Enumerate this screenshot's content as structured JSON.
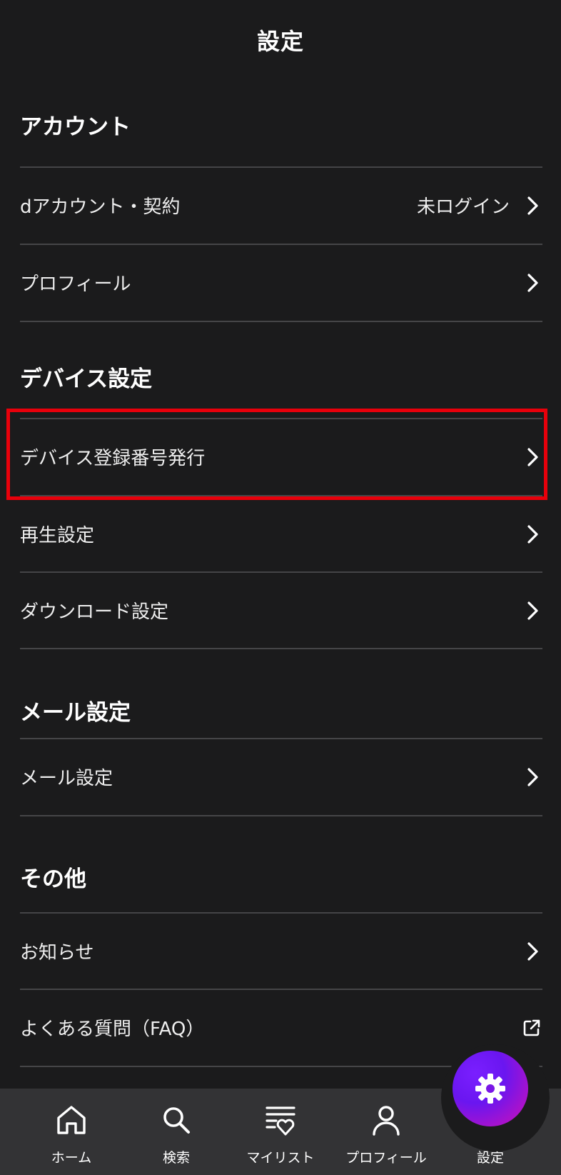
{
  "header": {
    "title": "設定"
  },
  "sections": {
    "account": {
      "title": "アカウント",
      "items": [
        {
          "label": "dアカウント・契約",
          "value": "未ログイン"
        },
        {
          "label": "プロフィール"
        }
      ]
    },
    "device": {
      "title": "デバイス設定",
      "items": [
        {
          "label": "デバイス登録番号発行"
        },
        {
          "label": "再生設定"
        },
        {
          "label": "ダウンロード設定"
        }
      ]
    },
    "mail": {
      "title": "メール設定",
      "items": [
        {
          "label": "メール設定"
        }
      ]
    },
    "other": {
      "title": "その他",
      "items": [
        {
          "label": "お知らせ"
        },
        {
          "label": "よくある質問（FAQ）",
          "icon": "external-link-icon"
        }
      ]
    }
  },
  "bottom_nav": {
    "items": [
      {
        "label": "ホーム",
        "icon": "home-icon"
      },
      {
        "label": "検索",
        "icon": "search-icon"
      },
      {
        "label": "マイリスト",
        "icon": "mylist-heart-icon"
      },
      {
        "label": "プロフィール",
        "icon": "person-icon"
      },
      {
        "label": "設定",
        "icon": "gear-icon",
        "active": true
      }
    ]
  },
  "colors": {
    "background": "#1b1b1c",
    "nav_background": "#333335",
    "divider": "#454547",
    "highlight_border": "#e8000b",
    "fab_gradient_start": "#6a16f0",
    "fab_gradient_end": "#c41098"
  }
}
